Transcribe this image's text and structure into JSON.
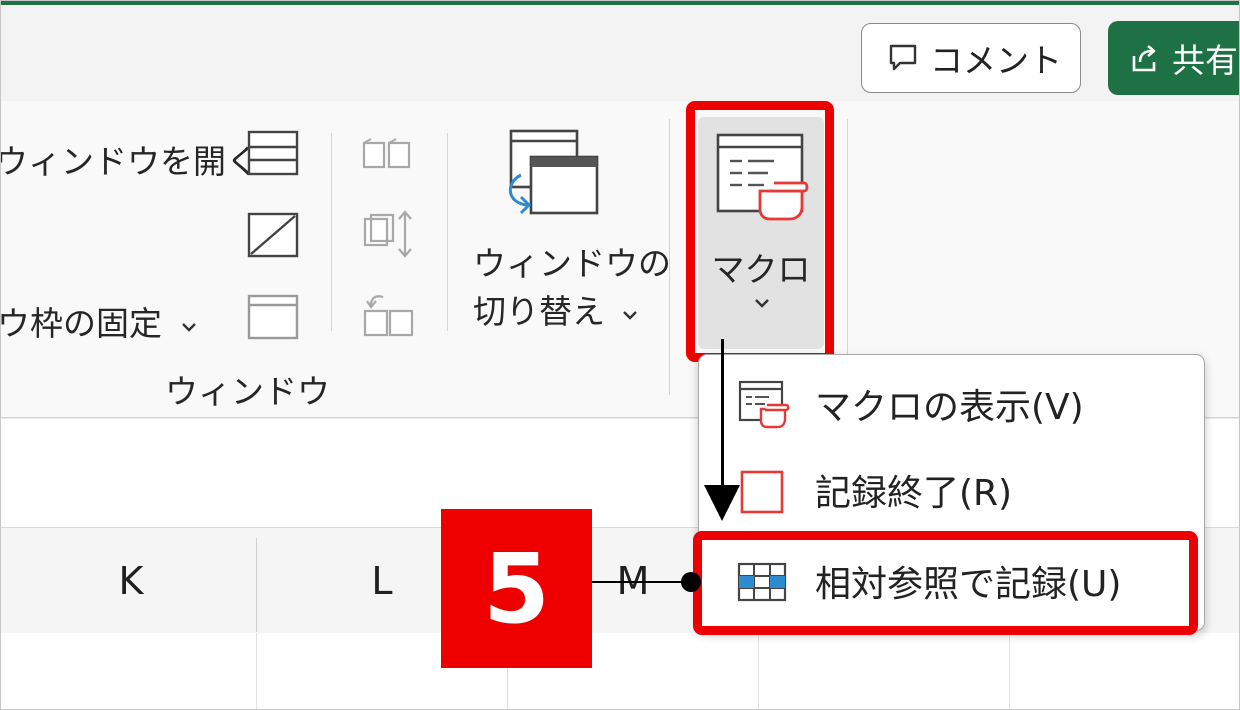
{
  "titlebar": {
    "comment_label": "コメント",
    "share_label": "共有"
  },
  "ribbon": {
    "new_window_label": "ウィンドウを開く",
    "freeze_panes_label": "ウ枠の固定",
    "switch_windows_line1": "ウィンドウの",
    "switch_windows_line2": "切り替え",
    "macro_label": "マクロ",
    "group_window_label": "ウィンドウ"
  },
  "columns": [
    "K",
    "L",
    "M"
  ],
  "macro_menu": {
    "items": [
      {
        "label": "マクロの表示(V)",
        "icon": "macro-list-icon"
      },
      {
        "label": "記録終了(R)",
        "icon": "stop-recording-icon"
      },
      {
        "label": "相対参照で記録(U)",
        "icon": "relative-reference-icon"
      }
    ]
  },
  "annotation": {
    "step_number": "5",
    "highlight_color": "#ee0000"
  },
  "colors": {
    "excel_green": "#1e7145",
    "highlight_red": "#ee0000",
    "icon_blue": "#2e8bd0"
  }
}
